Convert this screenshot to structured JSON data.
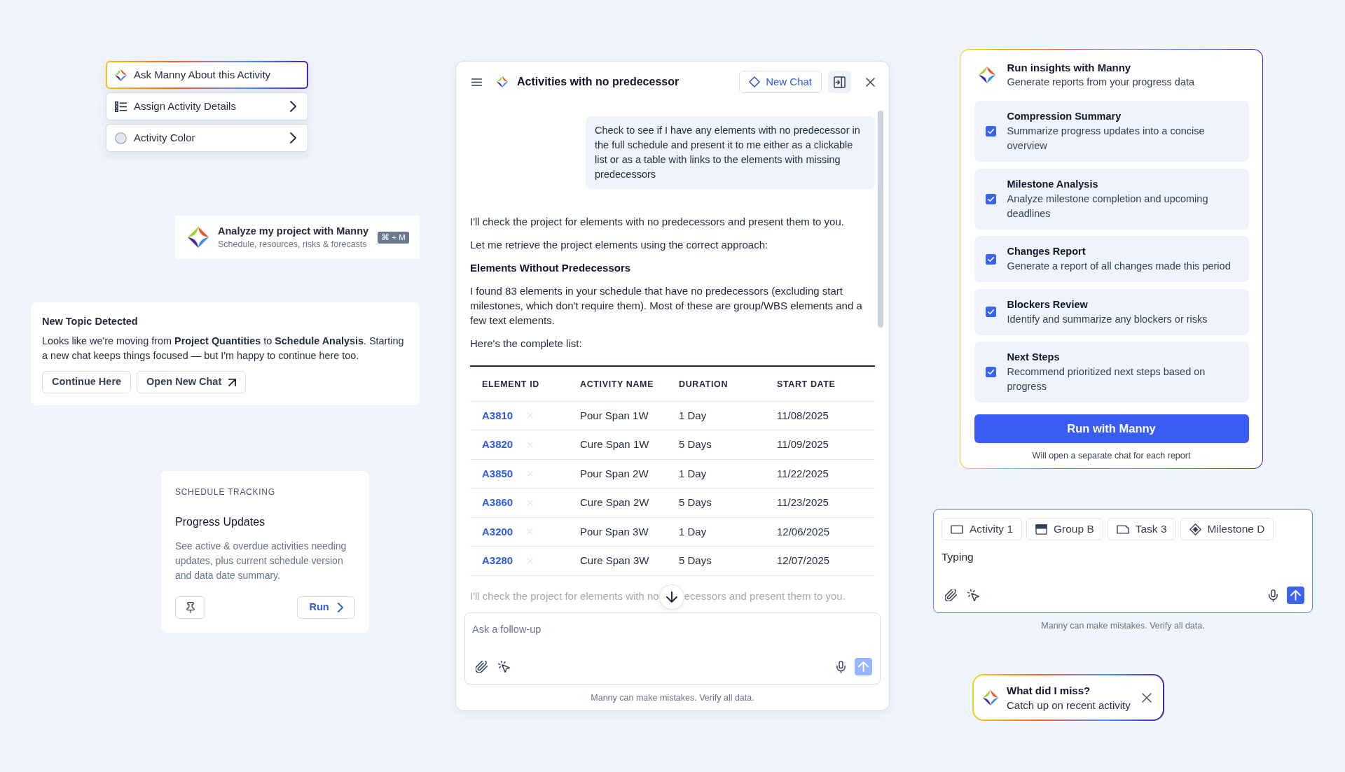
{
  "context_menu": {
    "items": [
      {
        "kind": "assistant",
        "label": "Ask Manny About this Activity"
      },
      {
        "kind": "details",
        "label": "Assign Activity Details"
      },
      {
        "kind": "color",
        "label": "Activity Color"
      }
    ]
  },
  "analyze_prompt": {
    "title": "Analyze my project with Manny",
    "subtitle": "Schedule, resources, risks & forecasts",
    "shortcut": "⌘ + M"
  },
  "topic_notice": {
    "title": "New Topic Detected",
    "message": "Looks like we're moving from **Project Quantities** to **Schedule Analysis**. Starting a new chat keeps things focused — but I'm happy to continue here too.",
    "buttons": [
      {
        "kind": "plain",
        "label": "Continue Here"
      },
      {
        "kind": "external",
        "label": "Open New Chat"
      }
    ]
  },
  "tracking_card": {
    "category": "SCHEDULE TRACKING",
    "title": "Progress Updates",
    "description": "See active & overdue activities needing updates, plus current schedule version and data date summary.",
    "run_button": "Run"
  },
  "chat": {
    "title": "Activities with no predecessor",
    "new_chat_button": "New Chat",
    "user_message": "Check to see if I have any elements with no predecessor in the full schedule and present it to me either as a clickable list or as a table with links to the elements with missing predecessors",
    "response": [
      {
        "kind": "paragraph",
        "text": "I'll check the project for elements with no predecessors and present them to you."
      },
      {
        "kind": "paragraph",
        "text": "Let me retrieve the project elements using the correct approach:"
      },
      {
        "kind": "heading",
        "text": "Elements Without Predecessors"
      },
      {
        "kind": "paragraph",
        "text": "I found 83 elements in your schedule that have no predecessors (excluding start milestones, which don't require them). Most of these are group/WBS elements and a few text elements."
      },
      {
        "kind": "paragraph",
        "text": "Here's the complete list:"
      }
    ],
    "table": {
      "columns": [
        "ELEMENT ID",
        "ACTIVITY NAME",
        "DURATION",
        "START DATE"
      ],
      "rows": [
        [
          "A3810",
          "Pour Span 1W",
          "1 Day",
          "11/08/2025"
        ],
        [
          "A3820",
          "Cure Span 1W",
          "5 Days",
          "11/09/2025"
        ],
        [
          "A3850",
          "Pour Span 2W",
          "1 Day",
          "11/22/2025"
        ],
        [
          "A3860",
          "Cure Span 2W",
          "5 Days",
          "11/23/2025"
        ],
        [
          "A3200",
          "Pour Span 3W",
          "1 Day",
          "12/06/2025"
        ],
        [
          "A3280",
          "Cure Span 3W",
          "5 Days",
          "12/07/2025"
        ]
      ]
    },
    "faded_text": [
      "I'll check the project for elements with no",
      "ecessors and present them to you."
    ],
    "input": {
      "placeholder": "Ask a follow-up",
      "send_enabled": false
    },
    "disclaimer": "Manny can make mistakes. Verify all data."
  },
  "insights": {
    "title": "Run insights with Manny",
    "subtitle": "Generate reports from your progress data",
    "reports": [
      {
        "title": "Compression Summary",
        "description": "Summarize progress updates into a concise overview",
        "checked": true
      },
      {
        "title": "Milestone Analysis",
        "description": "Analyze milestone completion and upcoming deadlines",
        "checked": true
      },
      {
        "title": "Changes Report",
        "description": "Generate a report of all changes made this period",
        "checked": true
      },
      {
        "title": "Blockers Review",
        "description": "Identify and summarize any blockers or risks",
        "checked": true
      },
      {
        "title": "Next Steps",
        "description": "Recommend prioritized next steps based on progress",
        "checked": true
      }
    ],
    "run_button": "Run with Manny",
    "note": "Will open a separate chat for each report"
  },
  "composer": {
    "chips": [
      {
        "kind": "activity",
        "label": "Activity 1"
      },
      {
        "kind": "group",
        "label": "Group B"
      },
      {
        "kind": "task",
        "label": "Task 3"
      },
      {
        "kind": "milestone",
        "label": "Milestone D"
      }
    ],
    "value": "Typing",
    "send_enabled": true,
    "disclaimer": "Manny can make mistakes. Verify all data."
  },
  "catch_up": {
    "title": "What did I miss?",
    "subtitle": "Catch up on recent activity"
  }
}
